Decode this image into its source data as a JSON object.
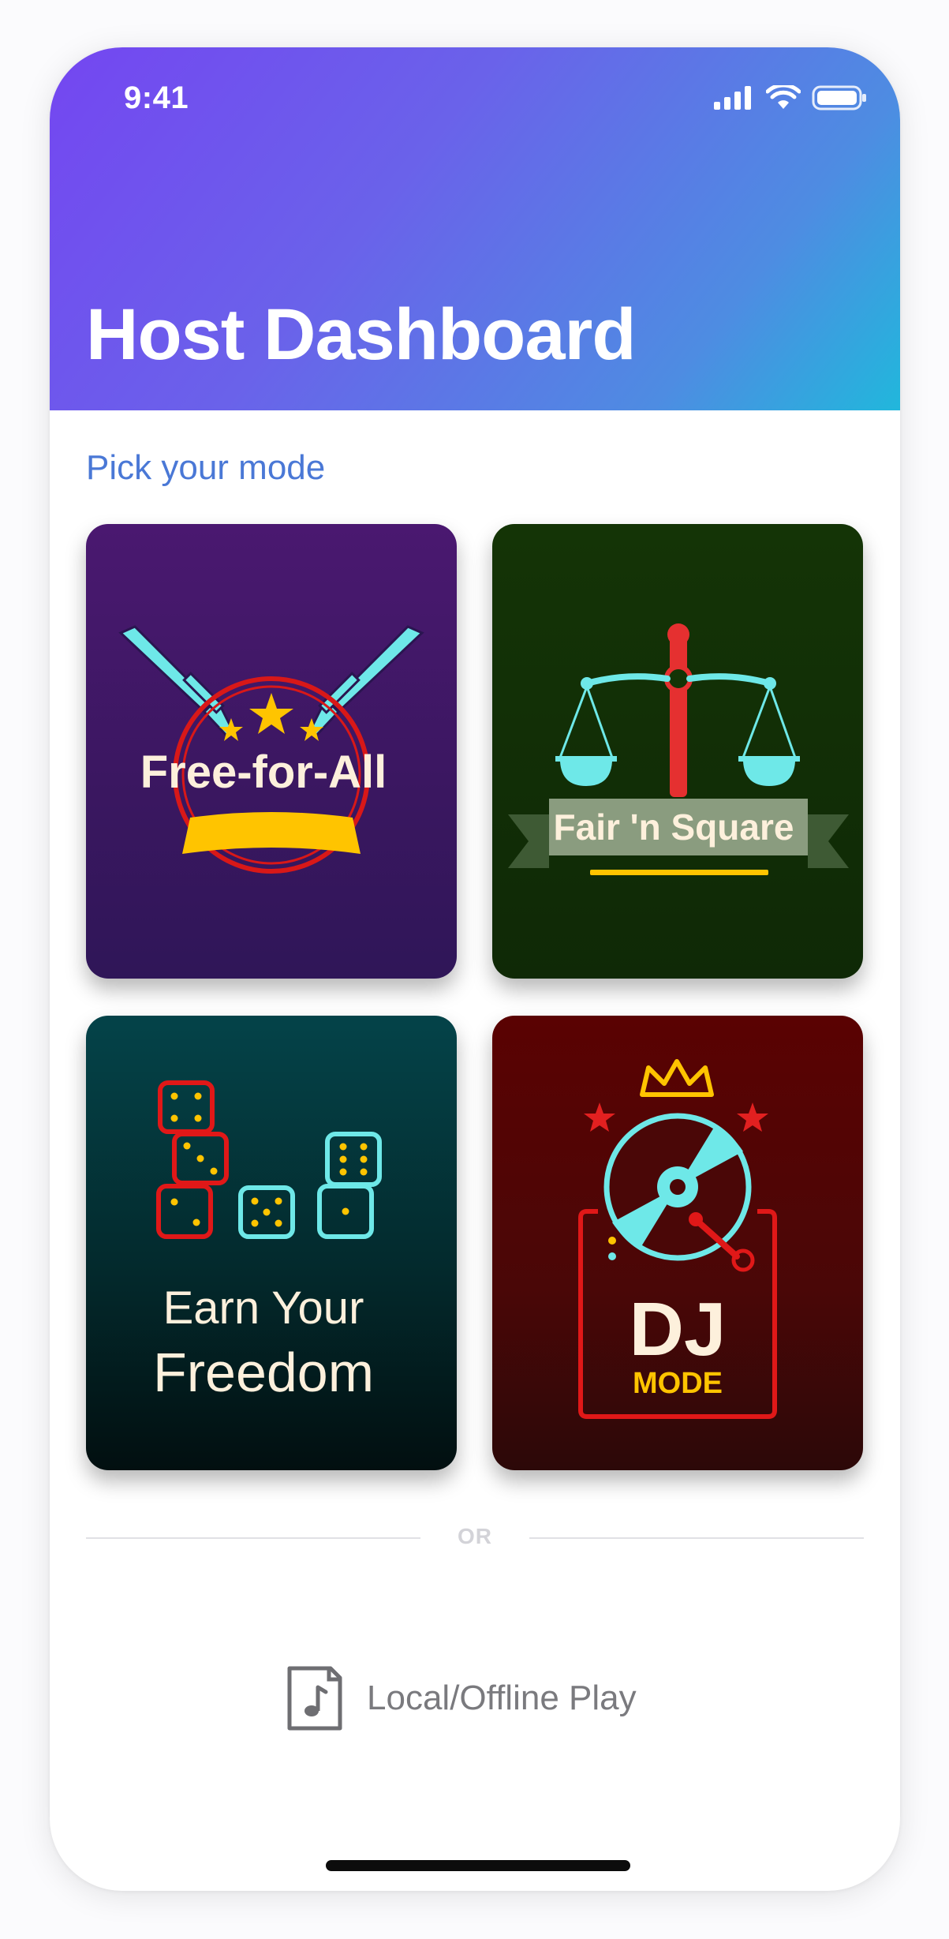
{
  "status_bar": {
    "time": "9:41"
  },
  "header": {
    "title": "Host Dashboard"
  },
  "section": {
    "label": "Pick your mode"
  },
  "modes": [
    {
      "id": "free-for-all",
      "label": "Free-for-All"
    },
    {
      "id": "fair-n-square",
      "label": "Fair 'n Square"
    },
    {
      "id": "earn-your-freedom",
      "line1": "Earn Your",
      "line2": "Freedom"
    },
    {
      "id": "dj-mode",
      "line1": "DJ",
      "line2": "MODE"
    }
  ],
  "divider": {
    "label": "OR"
  },
  "offline": {
    "label": "Local/Offline Play",
    "icon": "music-file-icon"
  },
  "colors": {
    "accent_blue": "#4a78d6",
    "header_gradient_start": "#7446f1",
    "header_gradient_end": "#21b7dc",
    "cyan": "#6ee8e8",
    "gold": "#ffc400",
    "red": "#d81818"
  }
}
